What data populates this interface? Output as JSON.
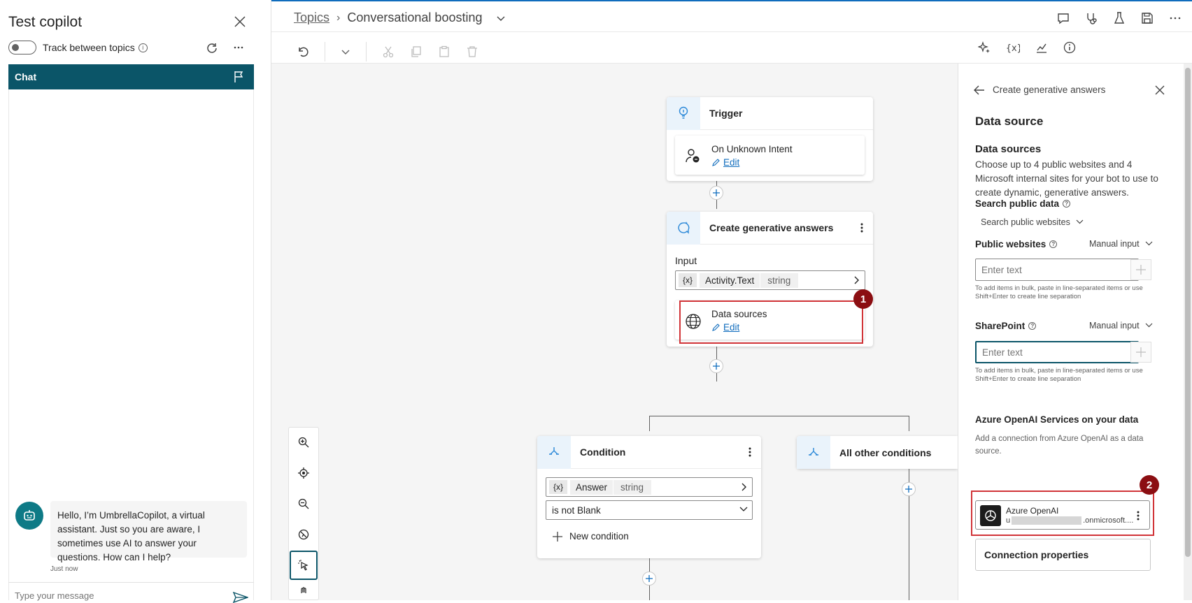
{
  "test_pane": {
    "title": "Test copilot",
    "track_label": "Track between topics",
    "chat_tab": "Chat",
    "bot_message": "Hello, I’m UmbrellaCopilot, a virtual assistant. Just so you are aware, I sometimes use AI to answer your questions. How can I help?",
    "bot_time": "Just now",
    "composer_placeholder": "Type your message"
  },
  "header": {
    "breadcrumb_root": "Topics",
    "topic_name": "Conversational boosting"
  },
  "canvas": {
    "trigger": {
      "title": "Trigger",
      "intent": "On Unknown Intent",
      "edit": "Edit"
    },
    "gen_answers": {
      "title": "Create generative answers",
      "input_label": "Input",
      "input_var_icon": "{x}",
      "input_var": "Activity.Text",
      "input_type": "string",
      "data_sources_label": "Data sources",
      "edit": "Edit"
    },
    "condition": {
      "title": "Condition",
      "var_icon": "{x}",
      "var": "Answer",
      "type": "string",
      "operator": "is not Blank",
      "new_condition": "New condition"
    },
    "other_conditions": {
      "title": "All other conditions"
    },
    "annotations": [
      "1",
      "2"
    ]
  },
  "panel": {
    "back_title": "Create generative answers",
    "heading": "Data source",
    "sources_heading": "Data sources",
    "sources_desc": "Choose up to 4 public websites and 4 Microsoft internal sites for your bot to use to create dynamic, generative answers.",
    "search_public_label": "Search public data",
    "search_public_value": "Search public websites",
    "public_websites_label": "Public websites",
    "public_websites_mode": "Manual input",
    "public_websites_placeholder": "Enter text",
    "bulk_hint": "To add items in bulk, paste in line-separated items or use Shift+Enter to create line separation",
    "sharepoint_label": "SharePoint",
    "sharepoint_mode": "Manual input",
    "sharepoint_placeholder": "Enter text",
    "azure_heading": "Azure OpenAI Services on your data",
    "azure_desc": "Add a connection from Azure OpenAI as a data source.",
    "connection_name": "Azure OpenAI",
    "connection_sub_prefix": "u",
    "connection_sub_suffix": ".onmicrosoft....",
    "connection_props": "Connection properties"
  },
  "colors": {
    "accent_teal": "#0b5568",
    "link_blue": "#0f6cbd",
    "annotation_red": "#d13438",
    "badge_red": "#8b0e12"
  }
}
